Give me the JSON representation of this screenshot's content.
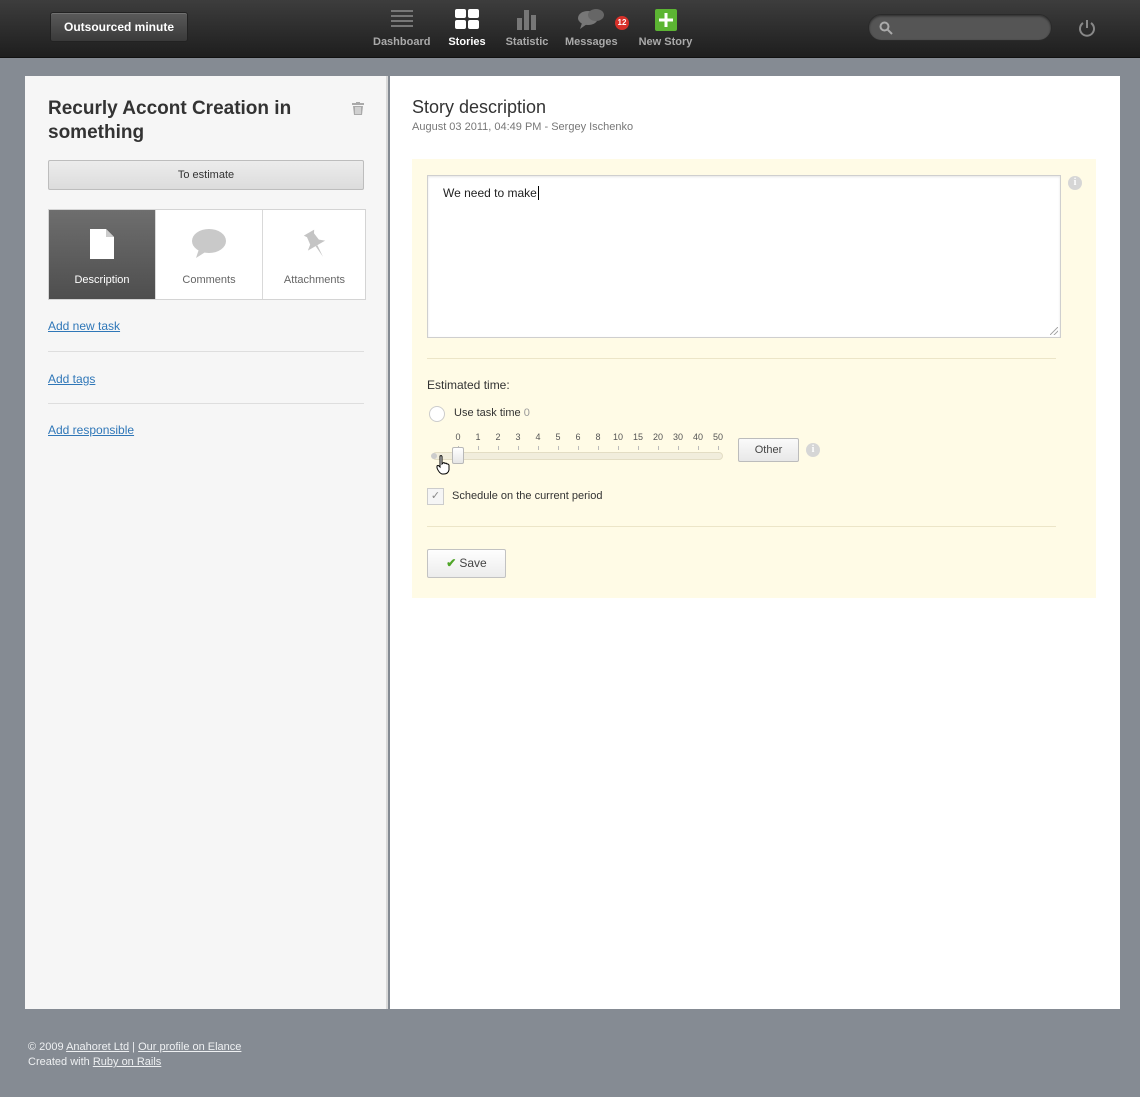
{
  "brand": "Outsourced minute",
  "nav": {
    "items": [
      {
        "label": "Dashboard",
        "icon": "dashboard-icon"
      },
      {
        "label": "Stories",
        "icon": "stories-icon"
      },
      {
        "label": "Statistic",
        "icon": "statistic-icon"
      },
      {
        "label": "Messages",
        "icon": "messages-icon"
      },
      {
        "label": "New Story",
        "icon": "plus-icon"
      }
    ],
    "active": "Stories",
    "messages_badge": "12"
  },
  "search": {
    "placeholder": ""
  },
  "story": {
    "title": "Recurly Accont Creation in something",
    "status_button": "To estimate",
    "tabs": [
      {
        "label": "Description"
      },
      {
        "label": "Comments"
      },
      {
        "label": "Attachments"
      }
    ],
    "links": [
      "Add new task",
      "Add tags",
      "Add responsible"
    ]
  },
  "description": {
    "title": "Story description",
    "meta": "August 03 2011, 04:49 PM - Sergey Ischenko",
    "text": "We need to make",
    "estimated_label": "Estimated time:",
    "use_task_time_label": "Use task time",
    "use_task_time_value": "0",
    "slider_ticks": [
      "0",
      "1",
      "2",
      "3",
      "4",
      "5",
      "6",
      "8",
      "10",
      "15",
      "20",
      "30",
      "40",
      "50"
    ],
    "slider_value": "0",
    "other_button": "Other",
    "schedule_label": "Schedule on the current period",
    "schedule_checked": true,
    "save_button": "Save"
  },
  "footer": {
    "copyright": "© 2009",
    "company_link": "Anahoret Ltd",
    "divider": "|",
    "profile_link": "Our profile on Elance",
    "created_with": "Created with",
    "rails_link": "Ruby on Rails"
  },
  "colors": {
    "page_bg": "#858b93",
    "topbar": "#2a2a2a",
    "link": "#2f77b8",
    "form_bg": "#fffbe6",
    "badge": "#d6312a",
    "new_story_green": "#5cb533"
  }
}
